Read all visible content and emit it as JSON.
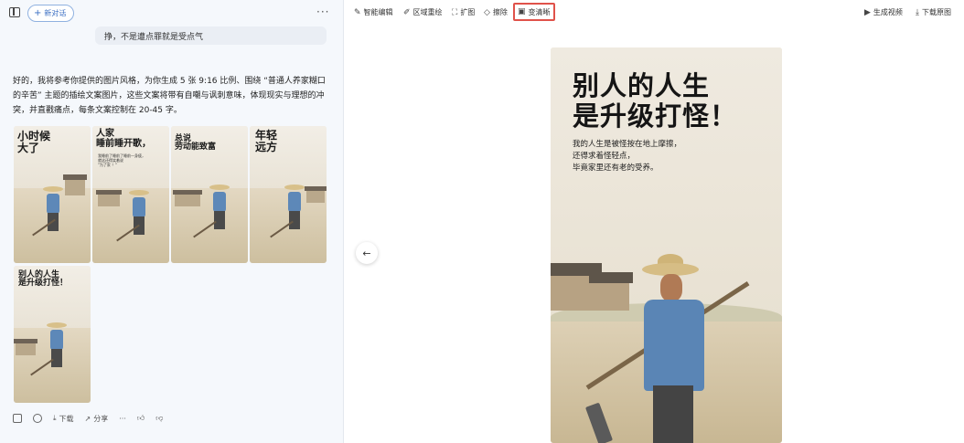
{
  "left": {
    "new_chat_label": "新对话",
    "user_message": "挣，不是遭点罪就是受点气",
    "answer_text": "好的，我将参考你提供的图片风格，为你生成 5 张 9:16 比例、围绕 “普通人养家糊口的辛苦” 主题的插绘文案图片，这些文案将带有自嘲与讽刺意味，体现现实与理想的冲突，并直戳痛点，每条文案控制在 20-45 字。",
    "thumbnails": [
      {
        "title": "小时候\n大了",
        "subtitle": ""
      },
      {
        "title": "人家\n睡前睡开歌，",
        "subtitle": "我睡前了睡前了睡前一身疲，\n就这还得笑着说\n\"为了家 ！\""
      },
      {
        "title": "总说\n劳动能致富",
        "subtitle": ""
      },
      {
        "title": "年轻\n远方",
        "subtitle": ""
      },
      {
        "title": "别人的人生\n是升级打怪！",
        "subtitle": ""
      }
    ],
    "actions": {
      "download": "下载",
      "share": "分享",
      "more": "···"
    }
  },
  "toolbar": {
    "smart_edit": "智能编辑",
    "region_redraw": "区域重绘",
    "expand": "扩图",
    "erase": "擦除",
    "enhance": "变清晰",
    "generate_video": "生成视频",
    "download_original": "下载原图"
  },
  "poster": {
    "title_line1": "别人的人生",
    "title_line2": "是升级打怪！",
    "sub_line1": "我的人生是被怪按在地上摩擦，",
    "sub_line2": "还得求着怪轻点，",
    "sub_line3": "毕竟家里还有老的受养。"
  }
}
